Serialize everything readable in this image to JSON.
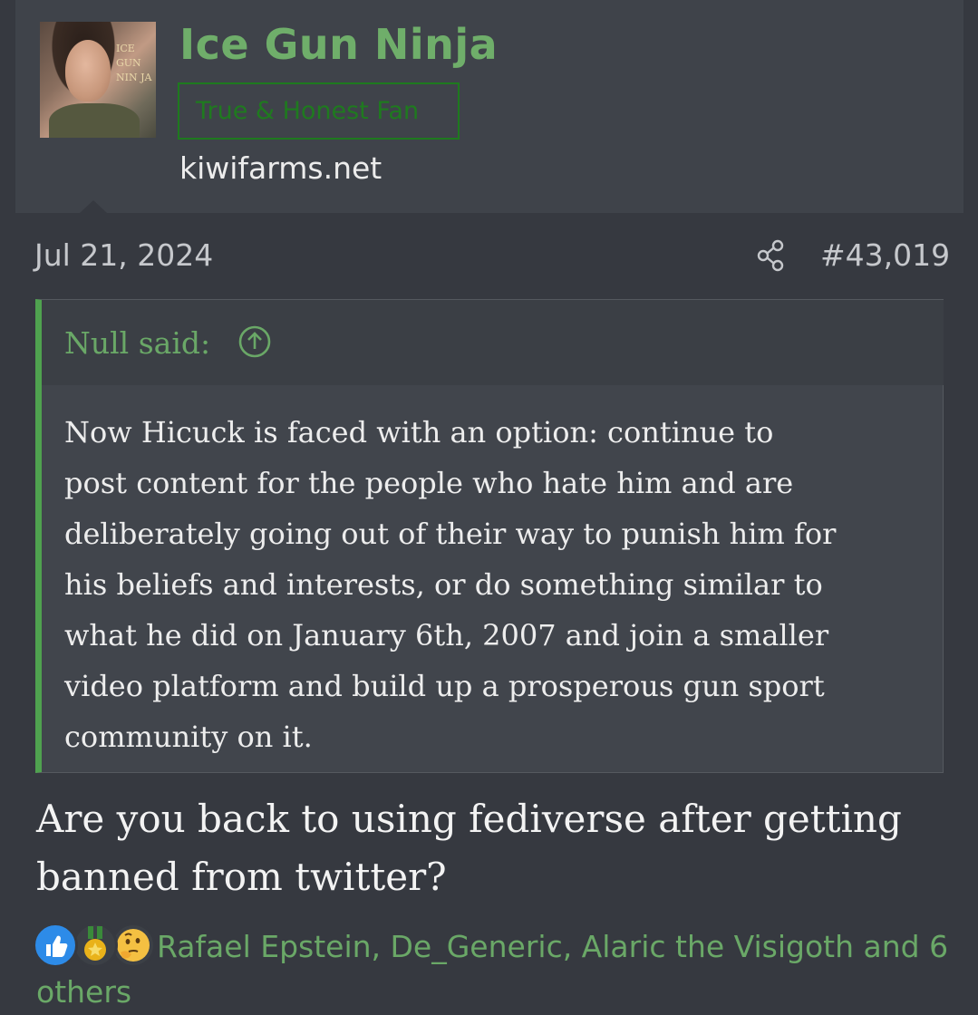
{
  "author": {
    "name": "Ice Gun Ninja",
    "title": "True & Honest Fan",
    "site": "kiwifarms.net",
    "avatar_logo_lines": [
      "ICE",
      "GUN",
      "NIN JA"
    ]
  },
  "post": {
    "date": "Jul 21, 2024",
    "number": "#43,019",
    "share_icon": "share-icon"
  },
  "quote": {
    "author_label": "Null said:",
    "expand_icon": "arrow-up-circle-icon",
    "body": "Now Hicuck is faced with an option: continue to\npost content for the people who hate him and are\ndeliberately going out of their way to punish him for\nhis beliefs and interests, or do something similar to\nwhat he did on January 6th, 2007 and join a smaller\nvideo platform and build up a prosperous gun sport\ncommunity on it."
  },
  "message": "Are you back to using fediverse after getting\nbanned from twitter?",
  "reactions": {
    "icons": [
      "like-icon",
      "medal-icon",
      "thinking-icon"
    ],
    "list_text": "Rafael Epstein, De_Generic, Alaric the Visigoth and 6 others"
  },
  "colors": {
    "background": "#363940",
    "header": "#3f434a",
    "accent_green": "#6fae6a",
    "quote_border": "#4fa24f",
    "title_border": "#1e7a1e"
  }
}
